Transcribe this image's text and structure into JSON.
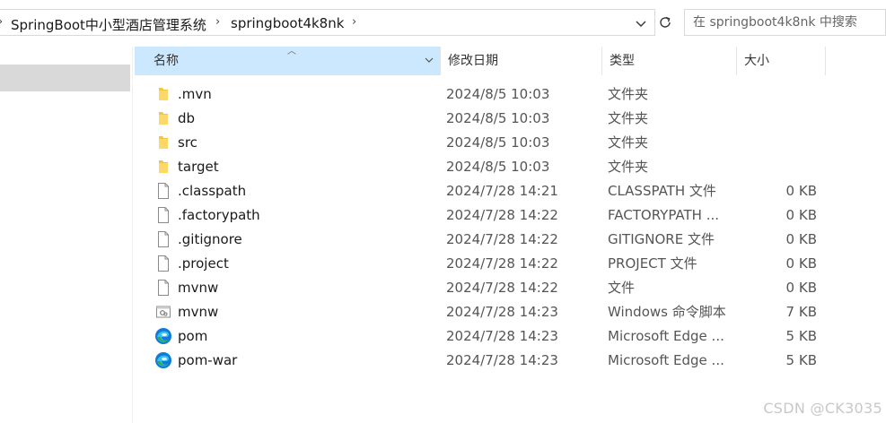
{
  "address_bar": {
    "crumbs": [
      "SpringBoot中小型酒店管理系统",
      "springboot4k8nk"
    ]
  },
  "search": {
    "placeholder": "在 springboot4k8nk 中搜索"
  },
  "columns": {
    "name": "名称",
    "date": "修改日期",
    "type": "类型",
    "size": "大小"
  },
  "files": [
    {
      "name": ".mvn",
      "date": "2024/8/5 10:03",
      "type": "文件夹",
      "size": "",
      "icon": "folder-icon"
    },
    {
      "name": "db",
      "date": "2024/8/5 10:03",
      "type": "文件夹",
      "size": "",
      "icon": "folder-icon"
    },
    {
      "name": "src",
      "date": "2024/8/5 10:03",
      "type": "文件夹",
      "size": "",
      "icon": "folder-icon"
    },
    {
      "name": "target",
      "date": "2024/8/5 10:03",
      "type": "文件夹",
      "size": "",
      "icon": "folder-icon"
    },
    {
      "name": ".classpath",
      "date": "2024/7/28 14:21",
      "type": "CLASSPATH 文件",
      "size": "0 KB",
      "icon": "file-icon"
    },
    {
      "name": ".factorypath",
      "date": "2024/7/28 14:22",
      "type": "FACTORYPATH ...",
      "size": "0 KB",
      "icon": "file-icon"
    },
    {
      "name": ".gitignore",
      "date": "2024/7/28 14:22",
      "type": "GITIGNORE 文件",
      "size": "0 KB",
      "icon": "file-icon"
    },
    {
      "name": ".project",
      "date": "2024/7/28 14:22",
      "type": "PROJECT 文件",
      "size": "0 KB",
      "icon": "file-icon"
    },
    {
      "name": "mvnw",
      "date": "2024/7/28 14:22",
      "type": "文件",
      "size": "0 KB",
      "icon": "file-icon"
    },
    {
      "name": "mvnw",
      "date": "2024/7/28 14:23",
      "type": "Windows 命令脚本",
      "size": "7 KB",
      "icon": "script-icon"
    },
    {
      "name": "pom",
      "date": "2024/7/28 14:23",
      "type": "Microsoft Edge ...",
      "size": "5 KB",
      "icon": "edge-icon"
    },
    {
      "name": "pom-war",
      "date": "2024/7/28 14:23",
      "type": "Microsoft Edge ...",
      "size": "5 KB",
      "icon": "edge-icon"
    }
  ],
  "watermark": "CSDN @CK3035",
  "colors": {
    "header_selected": "#cce8ff",
    "folder": "#f6c443",
    "edge": "#0f7ad8"
  }
}
